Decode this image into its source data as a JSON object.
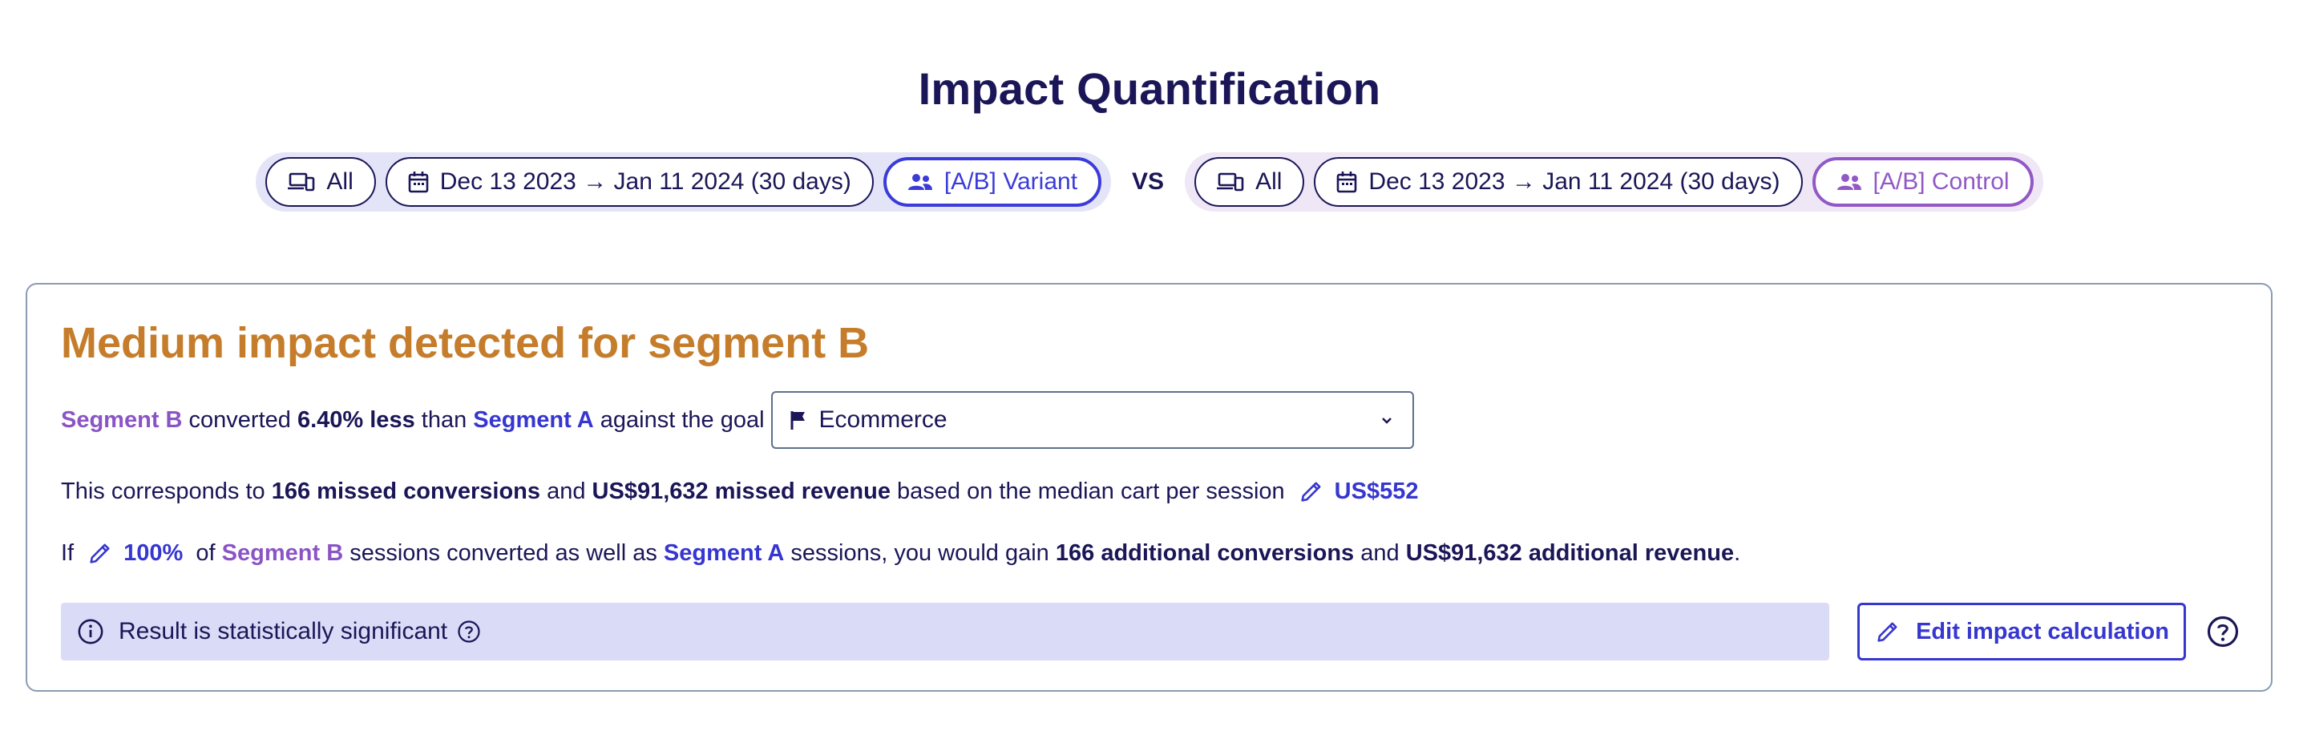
{
  "title": "Impact Quantification",
  "filters": {
    "left": {
      "device": "All",
      "date_range": "Dec 13 2023 → Jan 11 2024 (30 days)",
      "segment": "[A/B] Variant"
    },
    "vs": "VS",
    "right": {
      "device": "All",
      "date_range": "Dec 13 2023 → Jan 11 2024 (30 days)",
      "segment": "[A/B] Control"
    }
  },
  "card": {
    "heading": "Medium impact detected for segment B",
    "line1": {
      "segment_b": "Segment B",
      "t1": "converted",
      "percent": "6.40% less",
      "t2": "than",
      "segment_a": "Segment A",
      "t3": "against the goal"
    },
    "goal_select": {
      "value": "Ecommerce"
    },
    "line2": {
      "t1": "This corresponds to",
      "missed_conversions": "166 missed conversions",
      "t2": "and",
      "missed_revenue": "US$91,632 missed revenue",
      "t3": "based on the median cart per session",
      "median_cart": "US$552"
    },
    "line3": {
      "t1": "If",
      "percent": "100%",
      "t2": "of",
      "segment_b": "Segment B",
      "t3": "sessions converted as well as",
      "segment_a": "Segment A",
      "t4": "sessions, you would gain",
      "additional_conversions": "166 additional conversions",
      "t5": "and",
      "additional_revenue": "US$91,632 additional revenue",
      "t6": "."
    },
    "notice": "Result is statistically significant",
    "edit_button": "Edit impact calculation"
  },
  "colors": {
    "navy": "#1a1657",
    "orange": "#c57d2b",
    "blue": "#3636d0",
    "purple": "#8b54c4",
    "notice_bg": "#dadbf6"
  },
  "icons": [
    "devices-icon",
    "calendar-icon",
    "users-icon",
    "flag-icon",
    "chevron-down-icon",
    "pencil-icon",
    "info-icon",
    "help-icon"
  ]
}
